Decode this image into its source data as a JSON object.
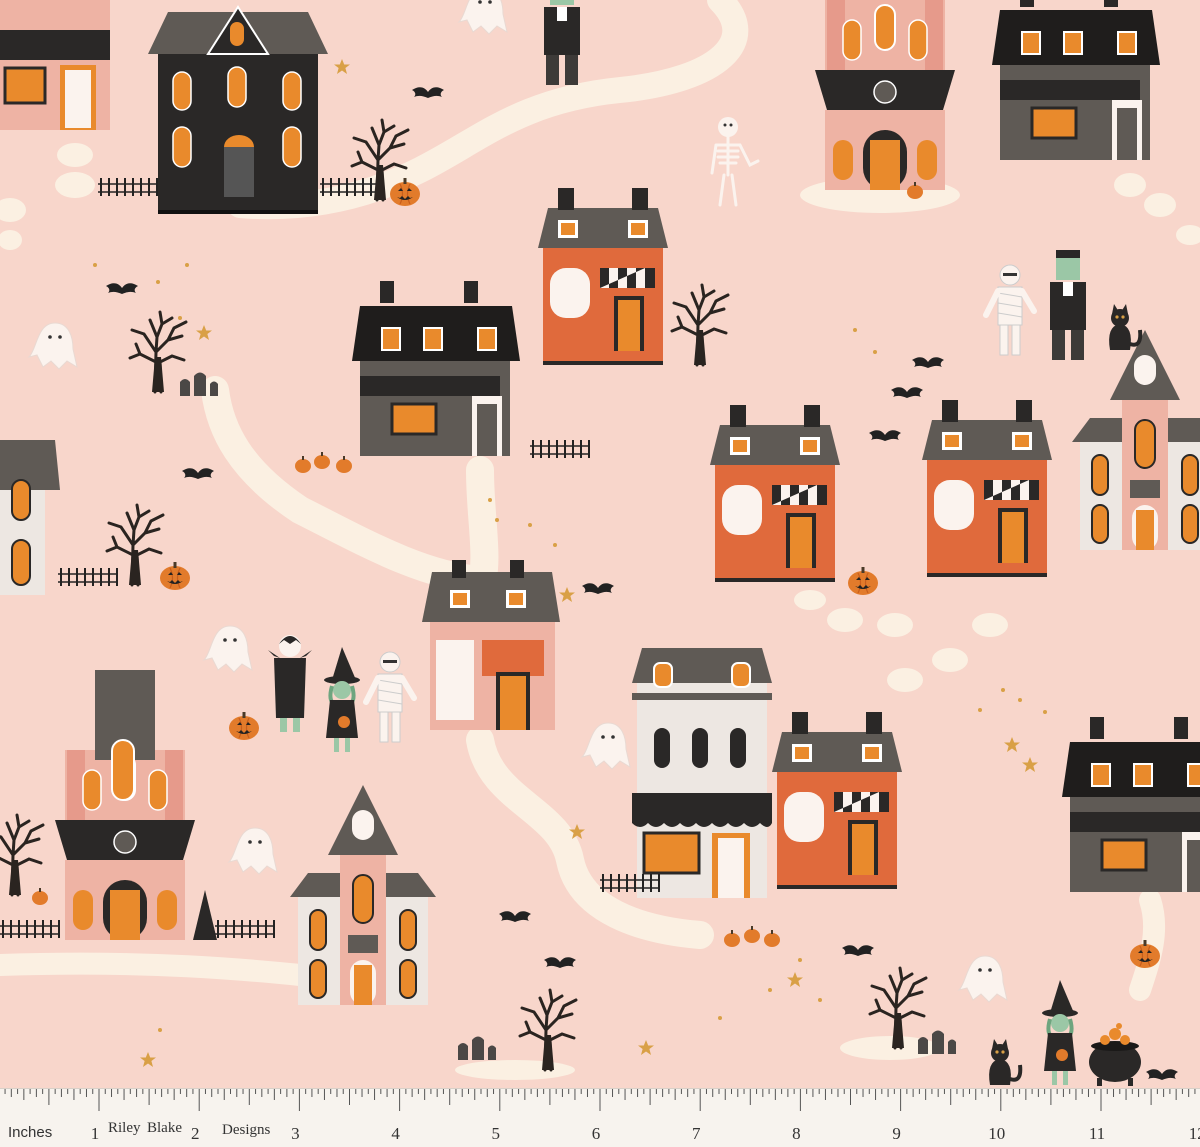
{
  "palette": {
    "background": "#f8d6cb",
    "path": "#fbf0e2",
    "house_black": "#2a2827",
    "house_gray": "#5f5a55",
    "house_pink": "#eeb3a4",
    "house_orange": "#e06a3c",
    "window_orange": "#e98a2c",
    "gold": "#d9a046",
    "ghost": "#fbf3ee"
  },
  "ruler": {
    "unit_label": "Inches",
    "brand_words": [
      "Riley",
      "Blake",
      "Designs"
    ],
    "numbers": [
      "1",
      "2",
      "3",
      "4",
      "5",
      "6",
      "7",
      "8",
      "9",
      "10",
      "11",
      "12"
    ]
  },
  "icons": [
    "haunted-house-icon",
    "ghost-icon",
    "bat-icon",
    "pumpkin-icon",
    "moon-icon",
    "star-icon",
    "tree-icon",
    "skeleton-icon",
    "vampire-icon",
    "witch-icon",
    "mummy-icon",
    "frankenstein-icon",
    "black-cat-icon",
    "cauldron-icon",
    "tombstone-icon"
  ]
}
